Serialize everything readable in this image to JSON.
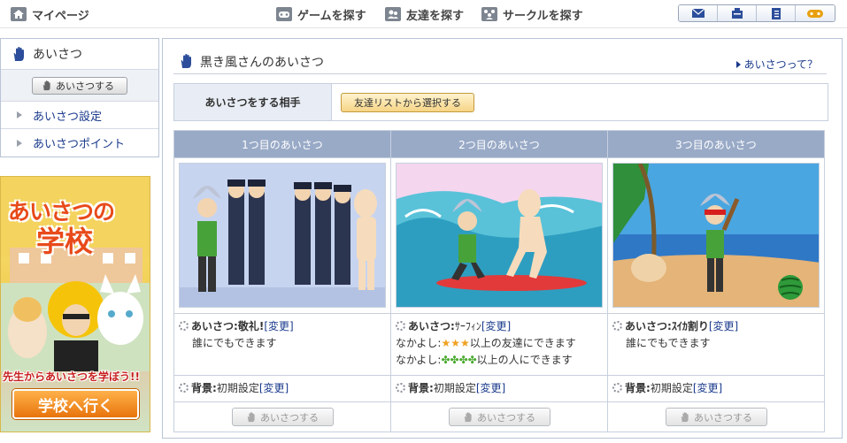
{
  "topbar": {
    "mypage": "マイページ",
    "game": "ゲームを探す",
    "friends": "友達を探す",
    "circle": "サークルを探す"
  },
  "sidebar": {
    "heading": "あいさつ",
    "greet_button": "あいさつする",
    "links": [
      "あいさつ設定",
      "あいさつポイント"
    ]
  },
  "banner": {
    "title_line1": "あいさつの",
    "title_line2": "学校",
    "subtitle": "先生からあいさつを学ぼう!!",
    "button": "学校へ行く"
  },
  "main": {
    "heading": "黒き風さんのあいさつ",
    "help_link": "あいさつって？",
    "target_label": "あいさつをする相手",
    "select_button": "友達リストから選択する",
    "columns": [
      {
        "header": "1つ目のあいさつ",
        "greet_label": "あいさつ",
        "greet_name": "敬礼!",
        "change": "[変更]",
        "lines": [
          "誰にでもできます"
        ],
        "bg_label": "背景",
        "bg_value": "初期設定",
        "bg_change": "[変更]",
        "button": "あいさつする"
      },
      {
        "header": "2つ目のあいさつ",
        "greet_label": "あいさつ",
        "greet_name": "ｻｰﾌｨﾝ",
        "change": "[変更]",
        "lines": [],
        "req1_prefix": "なかよし:",
        "req1_icons": "★★★",
        "req1_suffix": "以上の友達にできます",
        "req2_prefix": "なかよし:",
        "req2_icons": "✤✤✤✤",
        "req2_suffix": "以上の人にできます",
        "bg_label": "背景",
        "bg_value": "初期設定",
        "bg_change": "[変更]",
        "button": "あいさつする"
      },
      {
        "header": "3つ目のあいさつ",
        "greet_label": "あいさつ",
        "greet_name": "ｽｲｶ割り",
        "change": "[変更]",
        "lines": [
          "誰にでもできます"
        ],
        "bg_label": "背景",
        "bg_value": "初期設定",
        "bg_change": "[変更]",
        "button": "あいさつする"
      }
    ]
  },
  "colors": {
    "header_blue": "#99aac7",
    "link_blue": "#1a3a8c",
    "border": "#c7d0de",
    "orange": "#e8740c"
  }
}
